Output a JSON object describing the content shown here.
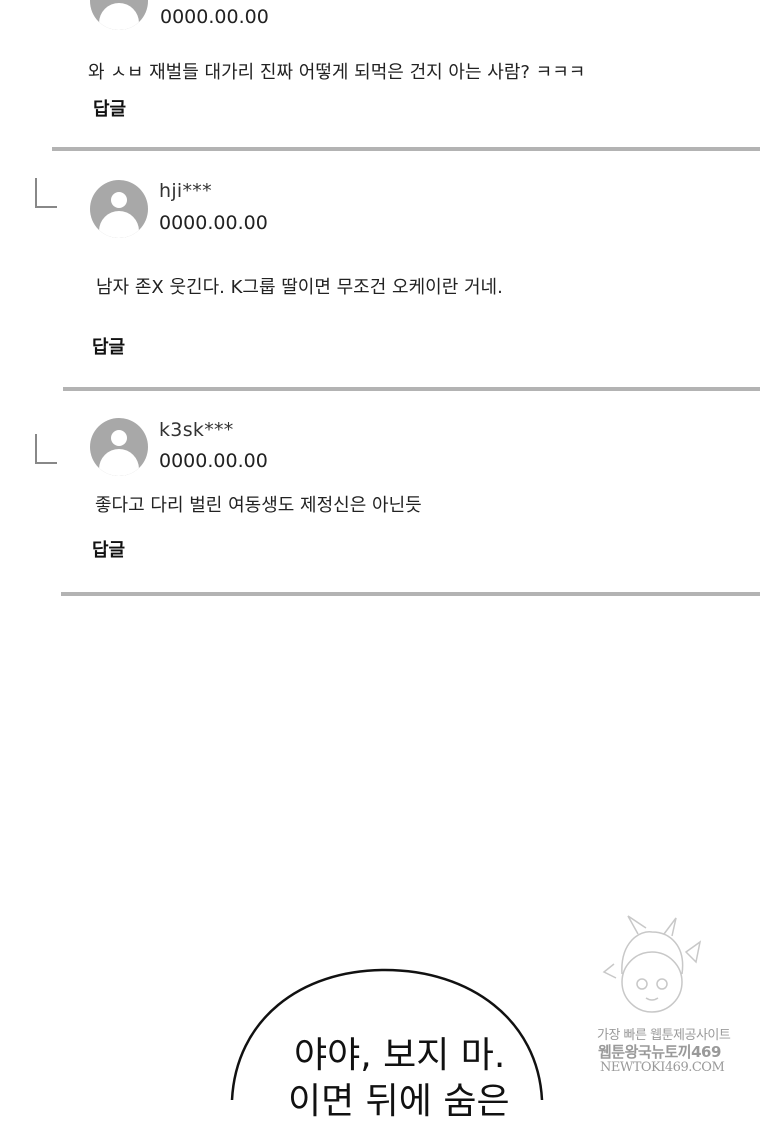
{
  "comments": [
    {
      "user": "",
      "date": "0000.00.00",
      "text": "와 ㅅㅂ 재벌들 대가리 진짜 어떻게 되먹은 건지 아는 사람? ㅋㅋㅋ",
      "reply_label": "답글"
    },
    {
      "user": "hji***",
      "date": "0000.00.00",
      "text": "남자 존X 웃긴다. K그룹 딸이면 무조건 오케이란 거네.",
      "reply_label": "답글"
    },
    {
      "user": "k3sk***",
      "date": "0000.00.00",
      "text": "좋다고 다리 벌린 여동생도 제정신은 아닌듯",
      "reply_label": "답글"
    }
  ],
  "speech_bubble": {
    "line1": "야야, 보지 마.",
    "line2": "이면 뒤에 숨은"
  },
  "watermark": {
    "line1": "가장 빠른 웹툰제공사이트",
    "line2": "웹툰왕국뉴토끼469",
    "line3": "NEWTOKI469.COM"
  }
}
